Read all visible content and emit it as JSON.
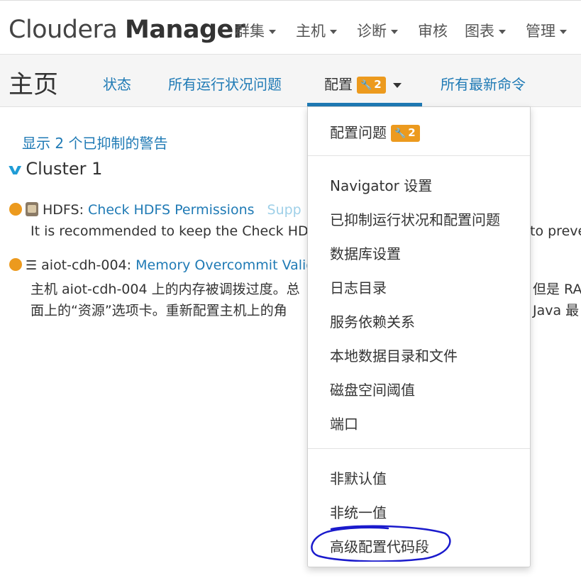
{
  "navbar": {
    "logo_light": "Cloudera",
    "logo_bold": "Manager",
    "menus": [
      "群集",
      "主机",
      "诊断",
      "审核",
      "图表",
      "管理"
    ]
  },
  "subnav": {
    "title": "主页",
    "tabs": [
      "状态",
      "所有运行状况问题",
      "配置",
      "所有最新命令"
    ],
    "config_badge": "2"
  },
  "main": {
    "suppressed_link": "显示 2 个已抑制的警告",
    "cluster_name": "Cluster 1",
    "alerts": [
      {
        "prefix": "HDFS:",
        "link": "Check HDFS Permissions",
        "action": "Supp",
        "description": "It is recommended to keep the Check HDF"
      },
      {
        "prefix": "aiot-cdh-004:",
        "link": "Memory Overcommit Valid",
        "description_line1": "主机 aiot-cdh-004 上的内存被调拨过度。总",
        "description_line2": "面上的“资源”选项卡。重新配置主机上的角"
      }
    ],
    "right_overflow": {
      "alert1": "to preve",
      "alert2_line1": "但是 RAI",
      "alert2_line2": "Java 最"
    }
  },
  "dropdown": {
    "header_item": "配置问题",
    "header_badge": "2",
    "group1": [
      "Navigator 设置",
      "已抑制运行状况和配置问题",
      "数据库设置",
      "日志目录",
      "服务依赖关系",
      "本地数据目录和文件",
      "磁盘空间阈值",
      "端口"
    ],
    "group2": [
      "非默认值",
      "非统一值",
      "高级配置代码段"
    ]
  },
  "colors": {
    "link": "#1f7ab5",
    "badge": "#ec9a1e",
    "annotation": "#1a1acc"
  }
}
